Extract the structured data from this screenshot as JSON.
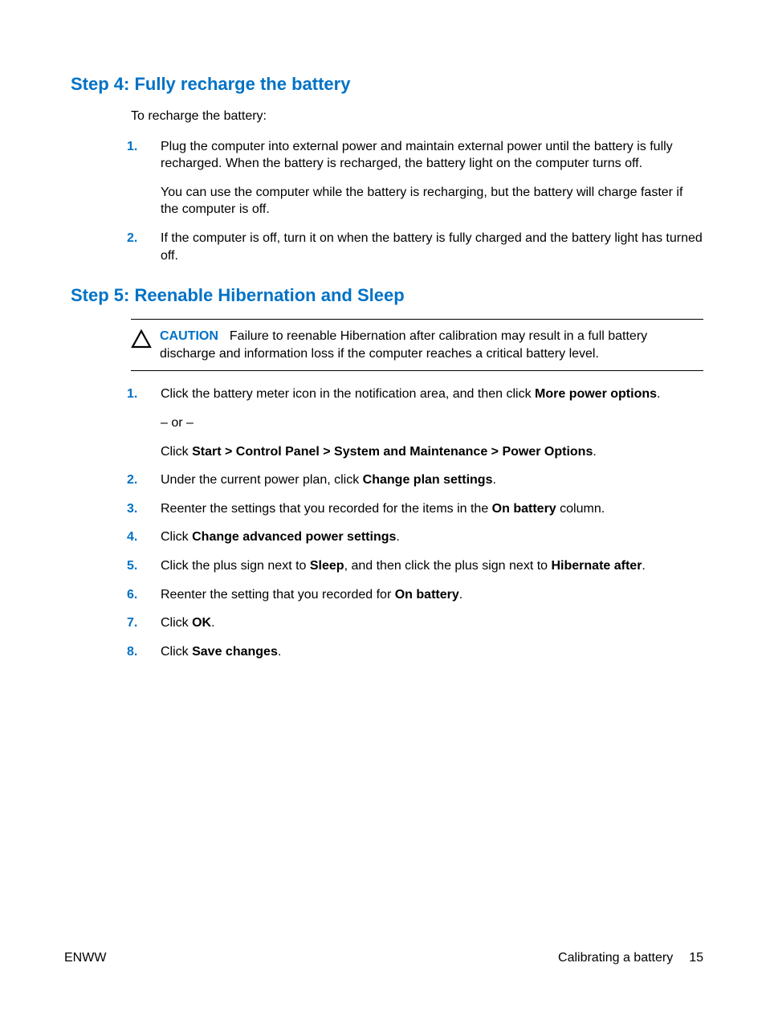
{
  "step4": {
    "heading": "Step 4: Fully recharge the battery",
    "intro": "To recharge the battery:",
    "items": [
      {
        "num": "1.",
        "p1": "Plug the computer into external power and maintain external power until the battery is fully recharged. When the battery is recharged, the battery light on the computer turns off.",
        "p2": "You can use the computer while the battery is recharging, but the battery will charge faster if the computer is off."
      },
      {
        "num": "2.",
        "p1": "If the computer is off, turn it on when the battery is fully charged and the battery light has turned off."
      }
    ]
  },
  "step5": {
    "heading": "Step 5: Reenable Hibernation and Sleep",
    "caution": {
      "label": "CAUTION",
      "text": "Failure to reenable Hibernation after calibration may result in a full battery discharge and information loss if the computer reaches a critical battery level."
    },
    "items": [
      {
        "num": "1.",
        "p1_pre": "Click the battery meter icon in the notification area, and then click ",
        "p1_b": "More power options",
        "p1_post": ".",
        "or": "– or –",
        "p2_pre": "Click ",
        "p2_b": "Start > Control Panel > System and Maintenance > Power Options",
        "p2_post": "."
      },
      {
        "num": "2.",
        "pre": "Under the current power plan, click ",
        "b": "Change plan settings",
        "post": "."
      },
      {
        "num": "3.",
        "pre": "Reenter the settings that you recorded for the items in the ",
        "b": "On battery",
        "post": " column."
      },
      {
        "num": "4.",
        "pre": "Click ",
        "b": "Change advanced power settings",
        "post": "."
      },
      {
        "num": "5.",
        "pre": "Click the plus sign next to ",
        "b": "Sleep",
        "mid": ", and then click the plus sign next to ",
        "b2": "Hibernate after",
        "post": "."
      },
      {
        "num": "6.",
        "pre": "Reenter the setting that you recorded for ",
        "b": "On battery",
        "post": "."
      },
      {
        "num": "7.",
        "pre": "Click ",
        "b": "OK",
        "post": "."
      },
      {
        "num": "8.",
        "pre": "Click ",
        "b": "Save changes",
        "post": "."
      }
    ]
  },
  "footer": {
    "left": "ENWW",
    "right_text": "Calibrating a battery",
    "page_num": "15"
  }
}
